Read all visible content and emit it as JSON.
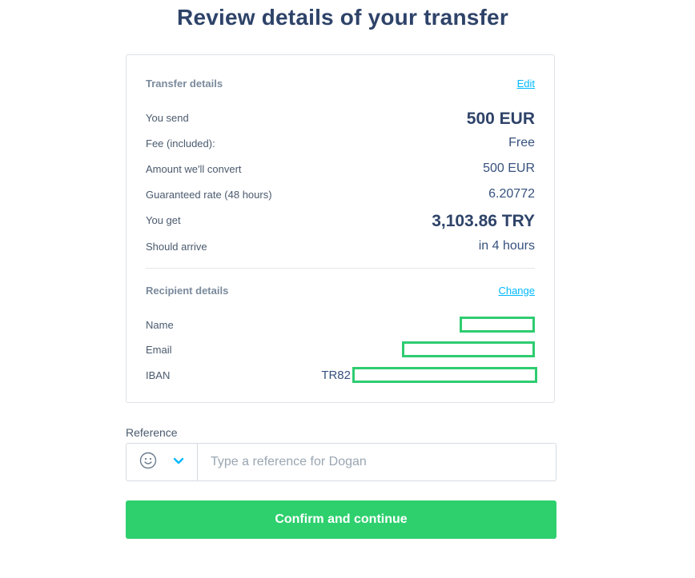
{
  "page": {
    "title": "Review details of your transfer"
  },
  "transfer": {
    "section_title": "Transfer details",
    "edit_label": "Edit",
    "rows": [
      {
        "label": "You send",
        "value": "500 EUR"
      },
      {
        "label": "Fee (included):",
        "value": "Free"
      },
      {
        "label": "Amount we'll convert",
        "value": "500 EUR"
      },
      {
        "label": "Guaranteed rate (48 hours)",
        "value": "6.20772"
      },
      {
        "label": "You get",
        "value": "3,103.86 TRY"
      },
      {
        "label": "Should arrive",
        "value": "in 4 hours"
      }
    ]
  },
  "recipient": {
    "section_title": "Recipient details",
    "change_label": "Change",
    "name_label": "Name",
    "email_label": "Email",
    "iban_label": "IBAN",
    "iban_prefix": "TR82"
  },
  "reference": {
    "label": "Reference",
    "placeholder": "Type a reference for Dogan",
    "emoji_icon": "smiley-icon",
    "dropdown_icon": "chevron-down-icon"
  },
  "confirm_button": {
    "label": "Confirm and continue"
  },
  "colors": {
    "accent_link": "#00b9ff",
    "confirm_green": "#2ed06e",
    "heading": "#2e4369",
    "redaction_outline": "#2ecc71"
  }
}
